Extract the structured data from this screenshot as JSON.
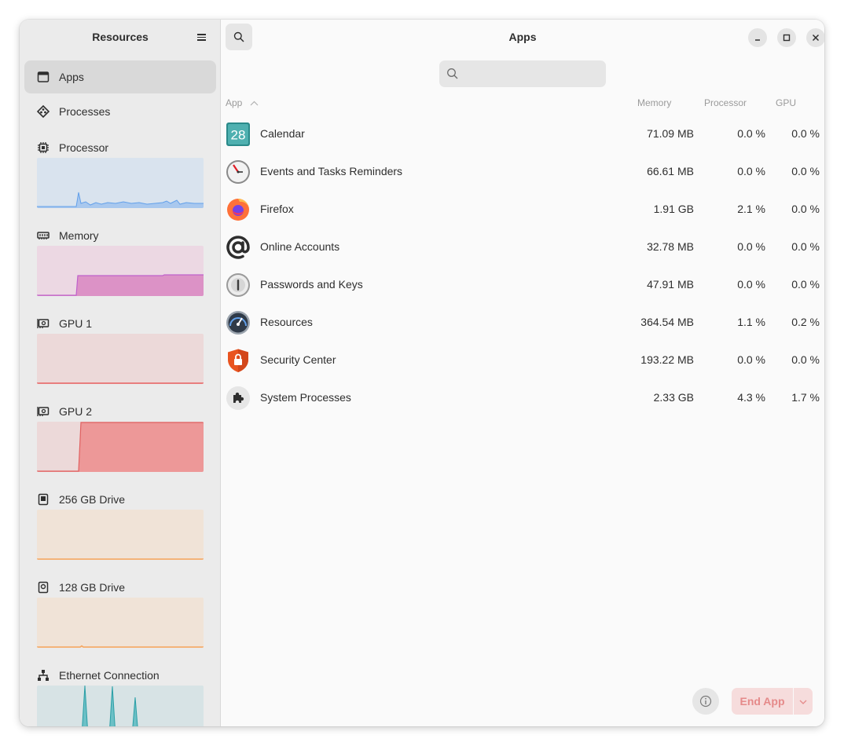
{
  "sidebar": {
    "title": "Resources",
    "nav": [
      {
        "label": "Apps",
        "icon": "apps-window-icon",
        "selected": true
      },
      {
        "label": "Processes",
        "icon": "processes-icon",
        "selected": false
      }
    ],
    "resources": [
      {
        "label": "Processor",
        "icon": "cpu-chip-icon",
        "color": "#62a0ea",
        "bg": "#d9e3ee"
      },
      {
        "label": "Memory",
        "icon": "memory-icon",
        "color": "#c061cb",
        "bg": "#ecd8e3"
      },
      {
        "label": "GPU 1",
        "icon": "gpu-icon",
        "color": "#e66100",
        "bg": "#ecd9d9"
      },
      {
        "label": "GPU 2",
        "icon": "gpu-icon",
        "color": "#e01b24",
        "bg": "#ecd9d9"
      },
      {
        "label": "256 GB Drive",
        "icon": "drive-icon",
        "color": "#f6a35a",
        "bg": "#f0e3d7"
      },
      {
        "label": "128 GB Drive",
        "icon": "drive-icon",
        "color": "#f6a35a",
        "bg": "#f0e3d7"
      },
      {
        "label": "Ethernet Connection",
        "icon": "network-icon",
        "color": "#2ec27e",
        "bg": "#d7e3e5"
      }
    ]
  },
  "header": {
    "title": "Apps",
    "search_placeholder": ""
  },
  "table": {
    "columns": {
      "app": "App",
      "memory": "Memory",
      "processor": "Processor",
      "gpu": "GPU"
    },
    "sort_column": "App",
    "rows": [
      {
        "name": "Calendar",
        "icon": "calendar-icon",
        "icon_text": "28",
        "memory": "71.09 MB",
        "processor": "0.0 %",
        "gpu": "0.0 %"
      },
      {
        "name": "Events and Tasks Reminders",
        "icon": "clock-reminder-icon",
        "memory": "66.61 MB",
        "processor": "0.0 %",
        "gpu": "0.0 %"
      },
      {
        "name": "Firefox",
        "icon": "firefox-icon",
        "memory": "1.91 GB",
        "processor": "2.1 %",
        "gpu": "0.0 %"
      },
      {
        "name": "Online Accounts",
        "icon": "at-sign-icon",
        "memory": "32.78 MB",
        "processor": "0.0 %",
        "gpu": "0.0 %"
      },
      {
        "name": "Passwords and Keys",
        "icon": "keyring-icon",
        "memory": "47.91 MB",
        "processor": "0.0 %",
        "gpu": "0.0 %"
      },
      {
        "name": "Resources",
        "icon": "resources-gauge-icon",
        "memory": "364.54 MB",
        "processor": "1.1 %",
        "gpu": "0.2 %"
      },
      {
        "name": "Security Center",
        "icon": "shield-lock-icon",
        "memory": "193.22 MB",
        "processor": "0.0 %",
        "gpu": "0.0 %"
      },
      {
        "name": "System Processes",
        "icon": "puzzle-icon",
        "memory": "2.33 GB",
        "processor": "4.3 %",
        "gpu": "1.7 %"
      }
    ]
  },
  "footer": {
    "end_label": "End App"
  }
}
